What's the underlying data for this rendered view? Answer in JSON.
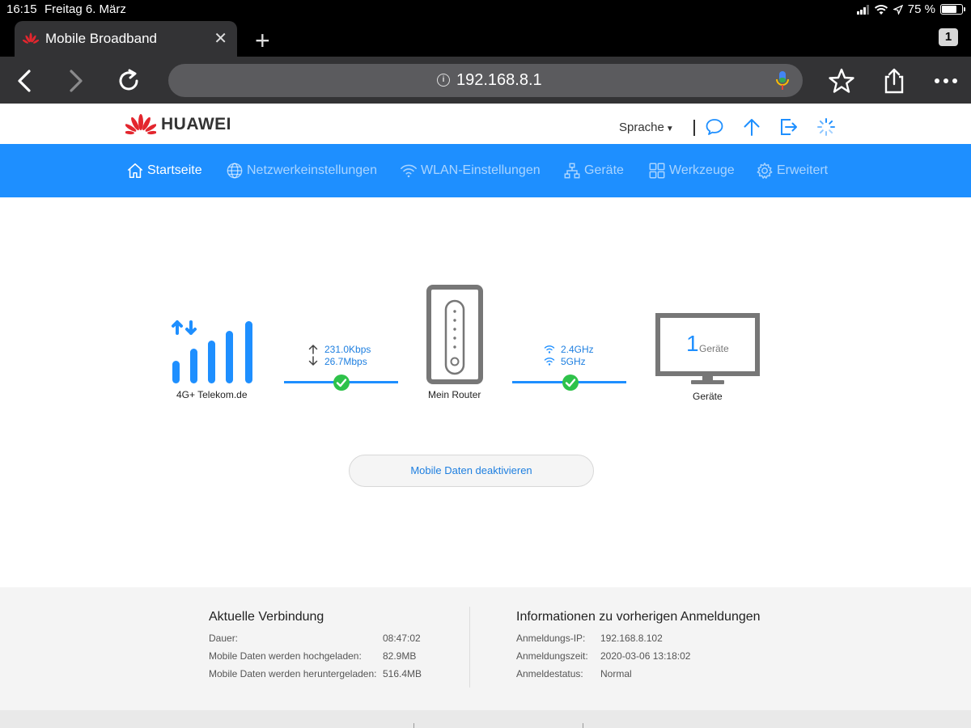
{
  "status_bar": {
    "time": "16:15",
    "date": "Freitag 6. März",
    "battery": "75 %"
  },
  "browser": {
    "tab_title": "Mobile Broadband",
    "tab_count": "1",
    "url": "192.168.8.1"
  },
  "header": {
    "brand": "HUAWEI",
    "language": "Sprache"
  },
  "nav": {
    "items": [
      {
        "label": "Startseite",
        "icon": "home-icon",
        "active": true
      },
      {
        "label": "Netzwerkeinstellungen",
        "icon": "globe-icon",
        "active": false
      },
      {
        "label": "WLAN-Einstellungen",
        "icon": "wifi-icon",
        "active": false
      },
      {
        "label": "Geräte",
        "icon": "devices-icon",
        "active": false
      },
      {
        "label": "Werkzeuge",
        "icon": "tools-icon",
        "active": false
      },
      {
        "label": "Erweitert",
        "icon": "settings-icon",
        "active": false
      }
    ]
  },
  "topology": {
    "network_label": "4G+ Telekom.de",
    "upload_speed": "231.0Kbps",
    "download_speed": "26.7Mbps",
    "router_label": "Mein Router",
    "wifi_band_1": "2.4GHz",
    "wifi_band_2": "5GHz",
    "device_count": "1",
    "device_count_label": "Geräte",
    "devices_label": "Geräte"
  },
  "actions": {
    "mobile_data_button": "Mobile Daten deaktivieren"
  },
  "current_connection": {
    "title": "Aktuelle Verbindung",
    "rows": [
      {
        "label": "Dauer:",
        "value": "08:47:02"
      },
      {
        "label": "Mobile Daten werden hochgeladen:",
        "value": "82.9MB"
      },
      {
        "label": "Mobile Daten werden heruntergeladen:",
        "value": "516.4MB"
      }
    ]
  },
  "previous_login": {
    "title": "Informationen zu vorherigen Anmeldungen",
    "rows": [
      {
        "label": "Anmeldungs-IP:",
        "value": "192.168.8.102"
      },
      {
        "label": "Anmeldungszeit:",
        "value": "2020-03-06 13:18:02"
      },
      {
        "label": "Anmeldestatus:",
        "value": "Normal"
      }
    ]
  },
  "colors": {
    "nav_blue": "#1e8fff",
    "link_blue": "#1e7fe0",
    "check_green": "#2ec24a",
    "huawei_red": "#e3262e"
  }
}
